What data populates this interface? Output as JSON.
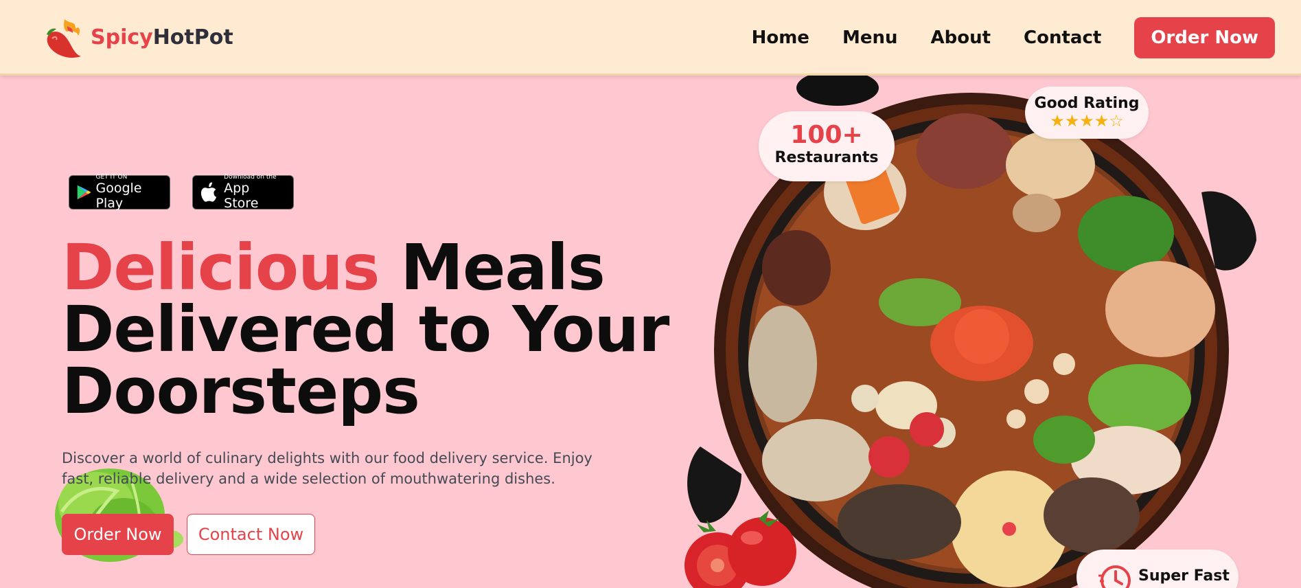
{
  "brand": {
    "part1": "Spicy",
    "part2": "HotPot"
  },
  "nav": {
    "links": [
      "Home",
      "Menu",
      "About",
      "Contact"
    ],
    "order_label": "Order Now"
  },
  "badges": {
    "google": {
      "small": "GET IT ON",
      "big": "Google Play"
    },
    "apple": {
      "small": "Download on the",
      "big": "App Store"
    }
  },
  "hero": {
    "highlight": "Delicious",
    "line1_rest": "Meals",
    "line2": "Delivered to Your",
    "line3": "Doorsteps",
    "description": "Discover a world of culinary delights with our food delivery service. Enjoy fast, reliable delivery and a wide selection of mouthwatering dishes.",
    "order_label": "Order Now",
    "contact_label": "Contact Now"
  },
  "stats": {
    "restaurants_count": "100+",
    "restaurants_label": "Restaurants",
    "rating_label": "Good Rating",
    "rating_value": 4,
    "rating_max": 5,
    "fast_label": "Super Fast"
  },
  "colors": {
    "accent": "#e5424a",
    "nav_bg": "#ffebd2",
    "page_bg": "#ffc8d0",
    "star": "#f6b10e"
  }
}
